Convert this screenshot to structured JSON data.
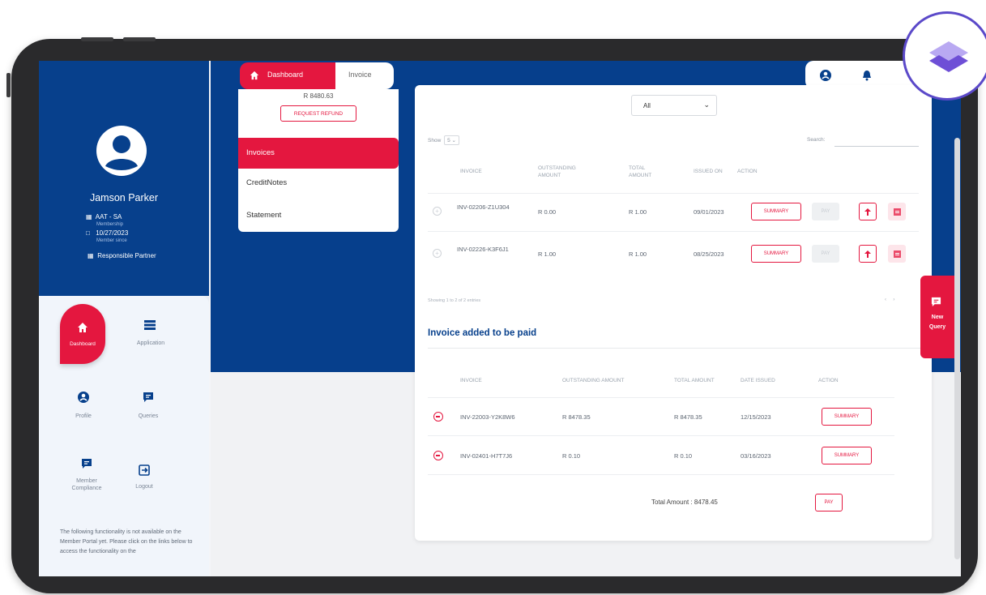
{
  "user": {
    "name": "Jamson Parker",
    "membership_code": "AAT - SA",
    "membership_label": "Membership",
    "member_since_date": "10/27/2023",
    "member_since_label": "Member since",
    "responsible_partner": "Responsible Partner"
  },
  "sidebar_nav": [
    {
      "label": "Dashboard",
      "icon": "home-icon"
    },
    {
      "label": "Application",
      "icon": "list-icon"
    },
    {
      "label": "Profile",
      "icon": "user-icon"
    },
    {
      "label": "Queries",
      "icon": "chat-icon"
    },
    {
      "label": "Member Compliance",
      "icon": "chat-icon"
    },
    {
      "label": "Logout",
      "icon": "logout-icon"
    }
  ],
  "sidebar_note": "The following functionality is not available on the Member Portal yet. Please click on the links below to access the functionality on the",
  "tabs": {
    "dashboard": "Dashboard",
    "invoice": "Invoice"
  },
  "balance": {
    "amount": "R 8480.63",
    "refund_label": "REQUEST REFUND"
  },
  "invoice_menu": [
    "Invoices",
    "CreditNotes",
    "Statement"
  ],
  "filter": {
    "selected": "All"
  },
  "table_controls": {
    "show_label": "Show",
    "show_value": "5",
    "search_label": "Search:"
  },
  "invoices_table": {
    "headers": [
      "INVOICE",
      "OUTSTANDING AMOUNT",
      "TOTAL AMOUNT",
      "ISSUED ON",
      "ACTION"
    ],
    "rows": [
      {
        "invoice": "INV-02206-Z1U304",
        "outstanding": "R 0.00",
        "total": "R 1.00",
        "issued": "09/01/2023"
      },
      {
        "invoice": "INV-02226-K3F6J1",
        "outstanding": "R 1.00",
        "total": "R 1.00",
        "issued": "08/25/2023"
      }
    ],
    "summary_label": "SUMMARY",
    "pay_label": "PAY",
    "footer": "Showing 1 to 2 of 2 entries"
  },
  "paid_section": {
    "title": "Invoice added to be paid",
    "headers": [
      "INVOICE",
      "OUTSTANDING AMOUNT",
      "TOTAL AMOUNT",
      "DATE ISSUED",
      "ACTION"
    ],
    "rows": [
      {
        "invoice": "INV-22003-Y2K8W6",
        "outstanding": "R 8478.35",
        "total": "R 8478.35",
        "date": "12/15/2023"
      },
      {
        "invoice": "INV-02401-H7T7J6",
        "outstanding": "R 0.10",
        "total": "R 0.10",
        "date": "03/16/2023"
      }
    ],
    "summary_label": "SUMMARY",
    "total_label": "Total Amount : 8478.45",
    "pay_label": "PAY"
  },
  "new_query": {
    "line1": "New",
    "line2": "Query"
  },
  "colors": {
    "brand_blue": "#063f8c",
    "accent_red": "#e4173f",
    "sidebar_bg": "#f1f5fb"
  }
}
